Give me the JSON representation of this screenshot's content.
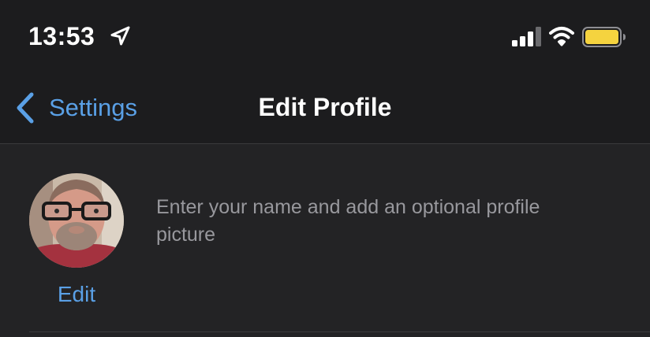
{
  "status_bar": {
    "time": "13:53",
    "location_icon": "location-arrow-icon",
    "signal_icon": "cellular-signal-icon",
    "wifi_icon": "wifi-icon",
    "battery_icon": "battery-icon",
    "battery_color": "#f5d33f"
  },
  "nav": {
    "back_label": "Settings",
    "back_icon": "chevron-left-icon",
    "title": "Edit Profile"
  },
  "profile": {
    "avatar": "user-photo",
    "edit_label": "Edit",
    "hint": "Enter your name and add an optional profile picture"
  },
  "colors": {
    "accent": "#5aa0e6",
    "background": "#1c1c1e",
    "section_background": "#232325",
    "secondary_text": "#98989d"
  }
}
